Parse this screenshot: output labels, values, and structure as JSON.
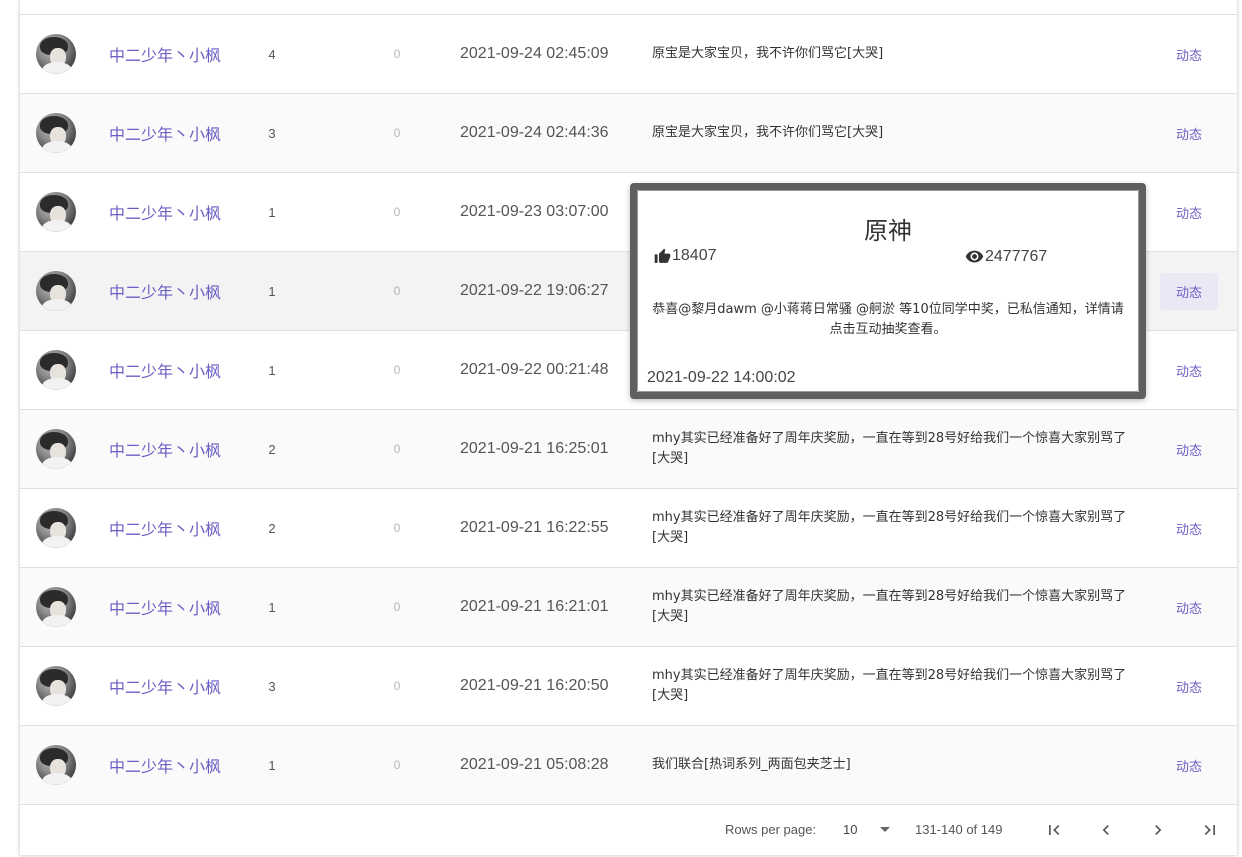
{
  "rows": [
    {
      "name": "中二少年丶小枫",
      "count": "4",
      "zero": "0",
      "time": "2021-09-24 02:45:09",
      "text": "原宝是大家宝贝，我不许你们骂它[大哭]",
      "action": "动态"
    },
    {
      "name": "中二少年丶小枫",
      "count": "3",
      "zero": "0",
      "time": "2021-09-24 02:44:36",
      "text": "原宝是大家宝贝，我不许你们骂它[大哭]",
      "action": "动态"
    },
    {
      "name": "中二少年丶小枫",
      "count": "1",
      "zero": "0",
      "time": "2021-09-23 03:07:00",
      "text": "",
      "action": "动态"
    },
    {
      "name": "中二少年丶小枫",
      "count": "1",
      "zero": "0",
      "time": "2021-09-22 19:06:27",
      "text": "",
      "action": "动态"
    },
    {
      "name": "中二少年丶小枫",
      "count": "1",
      "zero": "0",
      "time": "2021-09-22 00:21:48",
      "text": "",
      "action": "动态"
    },
    {
      "name": "中二少年丶小枫",
      "count": "2",
      "zero": "0",
      "time": "2021-09-21 16:25:01",
      "text": "mhy其实已经准备好了周年庆奖励，一直在等到28号好给我们一个惊喜大家别骂了[大哭]",
      "action": "动态"
    },
    {
      "name": "中二少年丶小枫",
      "count": "2",
      "zero": "0",
      "time": "2021-09-21 16:22:55",
      "text": "mhy其实已经准备好了周年庆奖励，一直在等到28号好给我们一个惊喜大家别骂了[大哭]",
      "action": "动态"
    },
    {
      "name": "中二少年丶小枫",
      "count": "1",
      "zero": "0",
      "time": "2021-09-21 16:21:01",
      "text": "mhy其实已经准备好了周年庆奖励，一直在等到28号好给我们一个惊喜大家别骂了[大哭]",
      "action": "动态"
    },
    {
      "name": "中二少年丶小枫",
      "count": "3",
      "zero": "0",
      "time": "2021-09-21 16:20:50",
      "text": "mhy其实已经准备好了周年庆奖励，一直在等到28号好给我们一个惊喜大家别骂了[大哭]",
      "action": "动态"
    },
    {
      "name": "中二少年丶小枫",
      "count": "1",
      "zero": "0",
      "time": "2021-09-21 05:08:28",
      "text": "我们联合[热词系列_两面包夹芝士]",
      "action": "动态"
    }
  ],
  "footer": {
    "rows_per_page_label": "Rows per page:",
    "rows_per_page_value": "10",
    "range": "131-140 of 149"
  },
  "popup": {
    "title": "原神",
    "likes": "18407",
    "views": "2477767",
    "body": "恭喜@黎月dawm @小蒋蒋日常骚 @舸淤 等10位同学中奖，已私信通知，详情请点击互动抽奖查看。",
    "time": "2021-09-22 14:00:02"
  },
  "icons": {
    "avatar": "user-avatar-photo",
    "first": "first-page-icon",
    "prev": "chevron-left-icon",
    "next": "chevron-right-icon",
    "last": "last-page-icon",
    "likes": "thumb-up-icon",
    "views": "eye-icon",
    "caret": "dropdown-caret-icon"
  },
  "colors": {
    "accent": "#6b5fc4",
    "popup_border": "#5f5f5f"
  }
}
